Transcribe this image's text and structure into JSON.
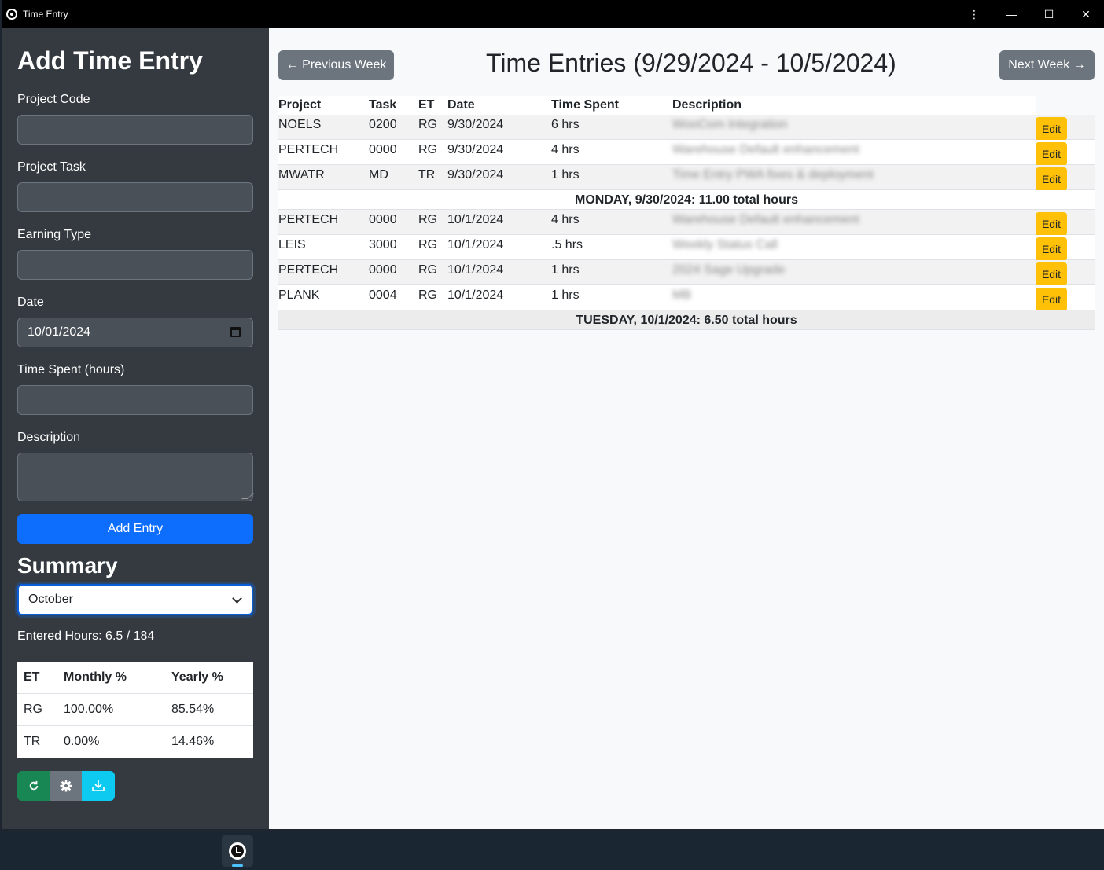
{
  "window": {
    "title": "Time Entry"
  },
  "form": {
    "heading": "Add Time Entry",
    "project_code_label": "Project Code",
    "project_code_value": "",
    "project_task_label": "Project Task",
    "project_task_value": "",
    "earning_type_label": "Earning Type",
    "earning_type_value": "",
    "date_label": "Date",
    "date_value": "10/01/2024",
    "time_spent_label": "Time Spent (hours)",
    "time_spent_value": "",
    "description_label": "Description",
    "description_value": "",
    "add_button": "Add Entry"
  },
  "summary": {
    "heading": "Summary",
    "month_selected": "October",
    "entered_hours": "Entered Hours: 6.5 / 184",
    "headers": [
      "ET",
      "Monthly %",
      "Yearly %"
    ],
    "rows": [
      {
        "et": "RG",
        "monthly": "100.00%",
        "yearly": "85.54%"
      },
      {
        "et": "TR",
        "monthly": "0.00%",
        "yearly": "14.46%"
      }
    ],
    "buttons": [
      "refresh-icon",
      "gear-icon",
      "download-icon"
    ]
  },
  "main": {
    "prev_button": "← Previous Week",
    "next_button": "Next Week →",
    "title": "Time Entries (9/29/2024 - 10/5/2024)",
    "headers": [
      "Project",
      "Task",
      "ET",
      "Date",
      "Time Spent",
      "Description"
    ],
    "edit_label": "Edit",
    "monday": [
      {
        "project": "NOELS",
        "task": "0200",
        "et": "RG",
        "date": "9/30/2024",
        "time": "6 hrs",
        "description": "WooCom Integration"
      },
      {
        "project": "PERTECH",
        "task": "0000",
        "et": "RG",
        "date": "9/30/2024",
        "time": "4 hrs",
        "description": "Warehouse Default enhancement"
      },
      {
        "project": "MWATR",
        "task": "MD",
        "et": "TR",
        "date": "9/30/2024",
        "time": "1 hrs",
        "description": "Time Entry PWA fixes & deployment"
      }
    ],
    "monday_total": "MONDAY, 9/30/2024: 11.00 total hours",
    "tuesday": [
      {
        "project": "PERTECH",
        "task": "0000",
        "et": "RG",
        "date": "10/1/2024",
        "time": "4 hrs",
        "description": "Warehouse Default enhancement"
      },
      {
        "project": "LEIS",
        "task": "3000",
        "et": "RG",
        "date": "10/1/2024",
        "time": ".5 hrs",
        "description": "Weekly Status Call"
      },
      {
        "project": "PERTECH",
        "task": "0000",
        "et": "RG",
        "date": "10/1/2024",
        "time": "1 hrs",
        "description": "2024 Sage Upgrade"
      },
      {
        "project": "PLANK",
        "task": "0004",
        "et": "RG",
        "date": "10/1/2024",
        "time": "1 hrs",
        "description": "MB"
      }
    ],
    "tuesday_total": "TUESDAY, 10/1/2024: 6.50 total hours"
  }
}
